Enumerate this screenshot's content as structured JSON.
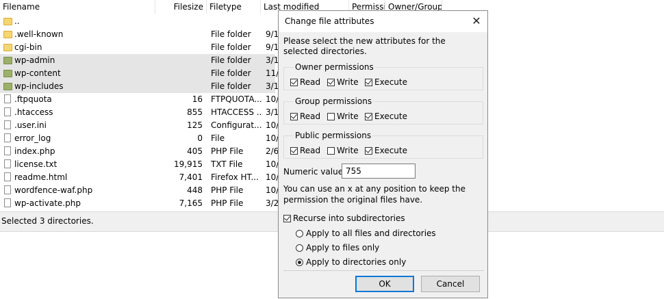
{
  "filelist": {
    "columns": {
      "filename": "Filename",
      "filesize": "Filesize",
      "filetype": "Filetype",
      "last_modified": "Last modified",
      "permissions": "Permissions",
      "owner_group": "Owner/Group"
    },
    "rows": [
      {
        "name": "..",
        "size": "",
        "type": "",
        "modified": "",
        "icon": "folder-icon",
        "selected": false
      },
      {
        "name": ".well-known",
        "size": "",
        "type": "File folder",
        "modified": "9/1",
        "icon": "folder-icon",
        "selected": false
      },
      {
        "name": "cgi-bin",
        "size": "",
        "type": "File folder",
        "modified": "9/1",
        "icon": "folder-icon",
        "selected": false
      },
      {
        "name": "wp-admin",
        "size": "",
        "type": "File folder",
        "modified": "3/1",
        "icon": "folder-icon",
        "selected": true
      },
      {
        "name": "wp-content",
        "size": "",
        "type": "File folder",
        "modified": "11/",
        "icon": "folder-icon",
        "selected": true
      },
      {
        "name": "wp-includes",
        "size": "",
        "type": "File folder",
        "modified": "3/1",
        "icon": "folder-icon",
        "selected": true
      },
      {
        "name": ".ftpquota",
        "size": "16",
        "type": "FTPQUOTA...",
        "modified": "10/",
        "icon": "file-icon",
        "selected": false
      },
      {
        "name": ".htaccess",
        "size": "855",
        "type": "HTACCESS ...",
        "modified": "3/1",
        "icon": "file-icon",
        "selected": false
      },
      {
        "name": ".user.ini",
        "size": "125",
        "type": "Configurat...",
        "modified": "10/",
        "icon": "config-file-icon",
        "selected": false
      },
      {
        "name": "error_log",
        "size": "0",
        "type": "File",
        "modified": "10/",
        "icon": "file-icon",
        "selected": false
      },
      {
        "name": "index.php",
        "size": "405",
        "type": "PHP File",
        "modified": "2/6",
        "icon": "file-icon",
        "selected": false
      },
      {
        "name": "license.txt",
        "size": "19,915",
        "type": "TXT File",
        "modified": "10/",
        "icon": "text-file-icon",
        "selected": false
      },
      {
        "name": "readme.html",
        "size": "7,401",
        "type": "Firefox HT...",
        "modified": "10/",
        "icon": "html-file-icon",
        "selected": false
      },
      {
        "name": "wordfence-waf.php",
        "size": "448",
        "type": "PHP File",
        "modified": "10/",
        "icon": "file-icon",
        "selected": false
      },
      {
        "name": "wp-activate.php",
        "size": "7,165",
        "type": "PHP File",
        "modified": "3/2",
        "icon": "file-icon",
        "selected": false
      }
    ]
  },
  "statusbar": {
    "text": "Selected 3 directories."
  },
  "dialog": {
    "title": "Change file attributes",
    "intro": "Please select the new attributes for the selected directories.",
    "groups": [
      {
        "label": "Owner permissions",
        "read": true,
        "write": true,
        "execute": true
      },
      {
        "label": "Group permissions",
        "read": true,
        "write": false,
        "execute": true
      },
      {
        "label": "Public permissions",
        "read": true,
        "write": false,
        "execute": true
      }
    ],
    "labels": {
      "read": "Read",
      "write": "Write",
      "execute": "Execute"
    },
    "numeric_label": "Numeric value:",
    "numeric_value": "755",
    "hint": "You can use an x at any position to keep the permission the original files have.",
    "recurse_label": "Recurse into subdirectories",
    "recurse_checked": true,
    "radios": [
      {
        "label": "Apply to all files and directories",
        "selected": false
      },
      {
        "label": "Apply to files only",
        "selected": false
      },
      {
        "label": "Apply to directories only",
        "selected": true
      }
    ],
    "ok_label": "OK",
    "cancel_label": "Cancel",
    "close_glyph": "✕"
  },
  "colors": {
    "selection": "#e5e5e5",
    "dialog_bg": "#f0f0f0",
    "ok_border": "#0078d7",
    "folder": "#f6d573"
  }
}
